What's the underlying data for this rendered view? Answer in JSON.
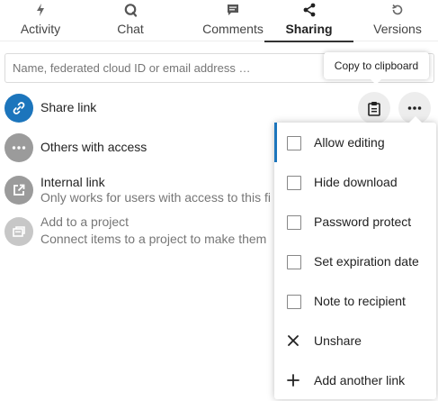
{
  "tabs": [
    {
      "label": "Activity",
      "icon": "lightning-icon"
    },
    {
      "label": "Chat",
      "icon": "chat-bubble-icon"
    },
    {
      "label": "Comments",
      "icon": "comment-icon"
    },
    {
      "label": "Sharing",
      "icon": "share-icon",
      "active": true
    },
    {
      "label": "Versions",
      "icon": "history-icon"
    }
  ],
  "search": {
    "placeholder": "Name, federated cloud ID or email address …"
  },
  "share_link": {
    "title": "Share link"
  },
  "others_with_access": {
    "title": "Others with access"
  },
  "internal_link": {
    "title": "Internal link",
    "subtitle": "Only works for users with access to this fi"
  },
  "add_project": {
    "title": "Add to a project",
    "subtitle": "Connect items to a project to make them"
  },
  "tooltip": {
    "text": "Copy to clipboard"
  },
  "menu": {
    "items": [
      {
        "label": "Allow editing",
        "type": "checkbox",
        "checked": false
      },
      {
        "label": "Hide download",
        "type": "checkbox",
        "checked": false
      },
      {
        "label": "Password protect",
        "type": "checkbox",
        "checked": false
      },
      {
        "label": "Set expiration date",
        "type": "checkbox",
        "checked": false
      },
      {
        "label": "Note to recipient",
        "type": "checkbox",
        "checked": false
      },
      {
        "label": "Unshare",
        "type": "action",
        "icon": "close-icon"
      },
      {
        "label": "Add another link",
        "type": "action",
        "icon": "plus-icon"
      }
    ]
  },
  "colors": {
    "accent": "#1c75bc",
    "avatar_grey": "#9b9b9b",
    "muted_text": "#767676"
  }
}
